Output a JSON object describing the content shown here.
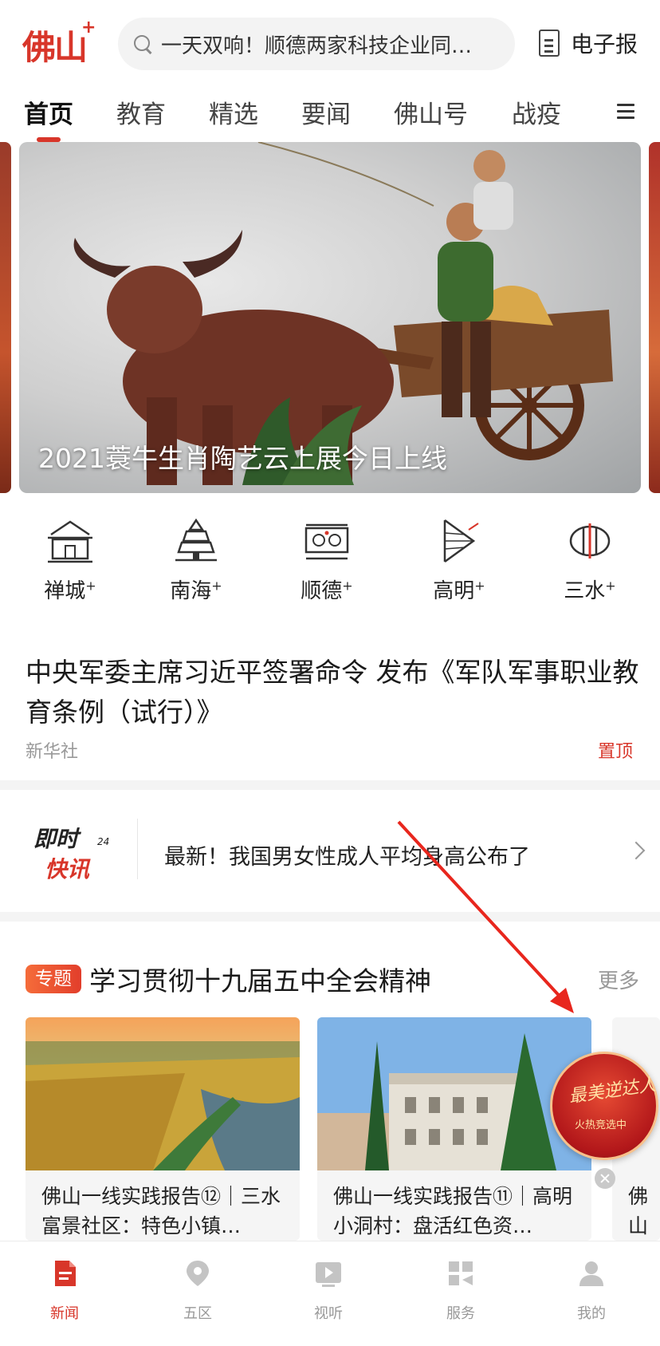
{
  "header": {
    "logo": "佛山",
    "logo_plus": "+",
    "search_text": "一天双响！顺德两家科技企业同…",
    "epaper_label": "电子报"
  },
  "tabs": [
    {
      "label": "首页",
      "active": true
    },
    {
      "label": "教育"
    },
    {
      "label": "精选"
    },
    {
      "label": "要闻"
    },
    {
      "label": "佛山号"
    },
    {
      "label": "战疫"
    }
  ],
  "banner": {
    "caption": "2021蓑牛生肖陶艺云上展今日上线"
  },
  "districts": [
    {
      "label": "禅城",
      "icon": "chancheng-icon"
    },
    {
      "label": "南海",
      "icon": "nanhai-icon"
    },
    {
      "label": "顺德",
      "icon": "shunde-icon"
    },
    {
      "label": "高明",
      "icon": "gaoming-icon"
    },
    {
      "label": "三水",
      "icon": "sanshui-icon"
    }
  ],
  "district_plus": "+",
  "top_story": {
    "title": "中央军委主席习近平签署命令 发布《军队军事职业教育条例（试行）》",
    "source": "新华社",
    "pin": "置顶"
  },
  "flash": {
    "logo_line1": "即时",
    "logo_line2": "快讯",
    "logo_num": "24",
    "text": "最新！我国男女性成人平均身高公布了"
  },
  "topic": {
    "badge": "专题",
    "title": "学习贯彻十九届五中全会精神",
    "more": "更多",
    "cards": [
      {
        "title": "佛山一线实践报告⑫｜三水富景社区：特色小镇…"
      },
      {
        "title": "佛山一线实践报告⑪｜高明小洞村：盘活红色资…"
      },
      {
        "title": "佛山镇佃"
      }
    ]
  },
  "promo": {
    "title": "最美逆达人",
    "subtitle": "火热竞选中"
  },
  "bottom_nav": [
    {
      "label": "新闻",
      "icon": "news-icon",
      "active": true
    },
    {
      "label": "五区",
      "icon": "location-icon"
    },
    {
      "label": "视听",
      "icon": "video-icon"
    },
    {
      "label": "服务",
      "icon": "services-icon"
    },
    {
      "label": "我的",
      "icon": "profile-icon"
    }
  ],
  "colors": {
    "accent": "#d8362a",
    "muted": "#999999"
  }
}
